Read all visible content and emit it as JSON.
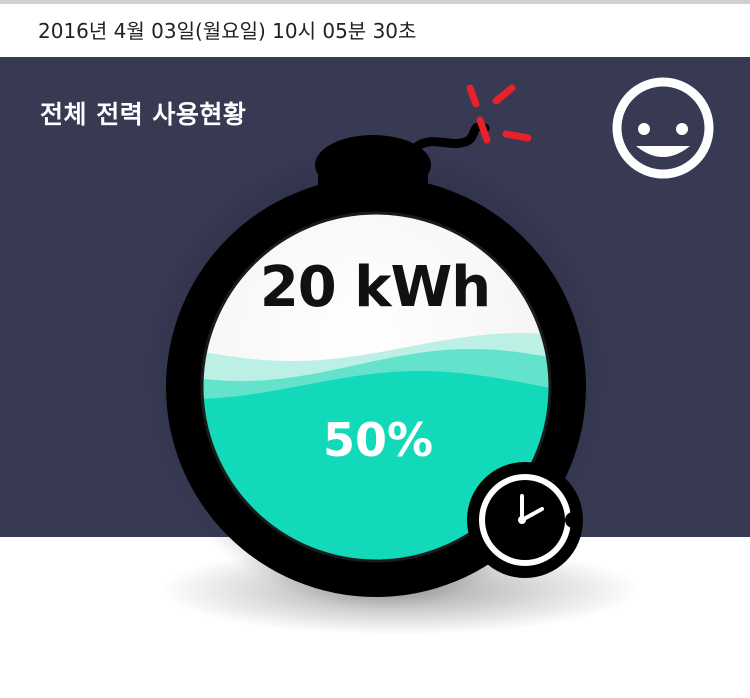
{
  "header": {
    "datetime": "2016년 4월 03일(월요일) 10시 05분 30초"
  },
  "panel": {
    "title": "전체 전력 사용현황",
    "status_icon": "smiley-face-icon",
    "colors": {
      "background": "#383a54",
      "water": "#12d9b9",
      "bomb": "#000000",
      "spark": "#e8202a"
    }
  },
  "gauge": {
    "energy": "20 kWh",
    "percent_label": "50%",
    "fill_fraction": 0.5,
    "timer_icon": "clock-icon"
  }
}
